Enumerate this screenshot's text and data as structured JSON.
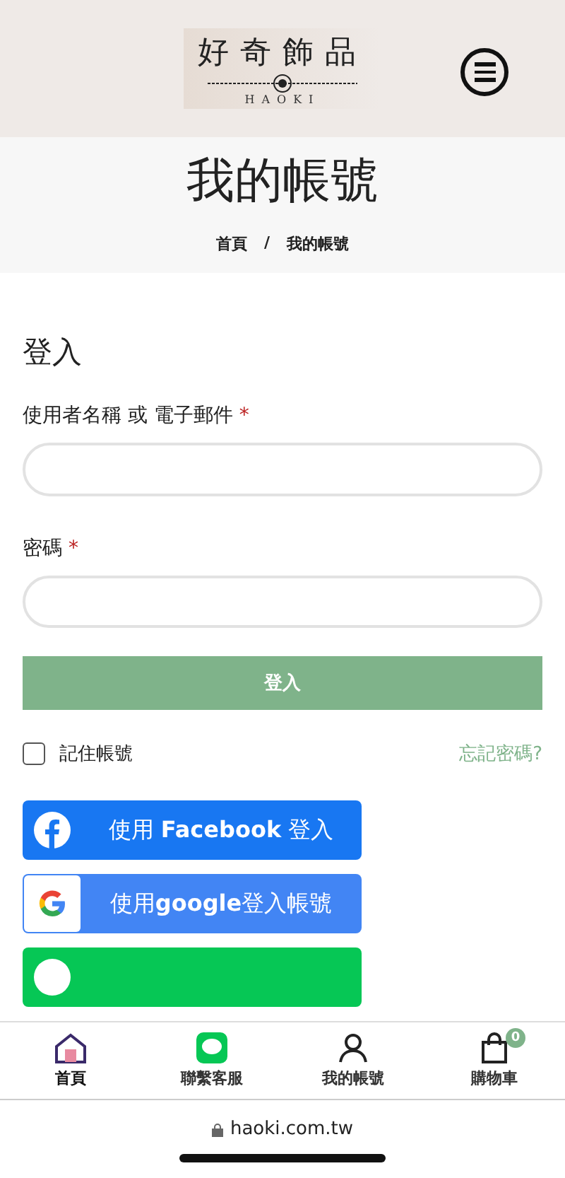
{
  "header": {
    "logo_text": "好奇飾品",
    "logo_subtitle": "HAOKI"
  },
  "page_title": "我的帳號",
  "breadcrumb": [
    "首頁",
    "/",
    "我的帳號"
  ],
  "login": {
    "heading": "登入",
    "fields": [
      {
        "label": "使用者名稱 或 電子郵件",
        "required_mark": "*"
      },
      {
        "label": "密碼",
        "required_mark": "*"
      }
    ],
    "submit": "登入",
    "remember": {
      "label": "記住帳號",
      "checked": false
    },
    "forgot": "忘記密碼?"
  },
  "social_buttons": [
    {
      "kind": "facebook",
      "label": "使用 **Facebook** 登入"
    },
    {
      "kind": "google",
      "label": "使用**google**登入帳號"
    },
    {
      "kind": "line"
    }
  ],
  "tab_bar": [
    {
      "kind": "home",
      "label": "首頁",
      "selected": true
    },
    {
      "kind": "chat",
      "label": "聯繫客服",
      "selected": false
    },
    {
      "kind": "user",
      "label": "我的帳號",
      "selected": false
    },
    {
      "kind": "cart",
      "label": "購物車",
      "selected": false,
      "badge": "0"
    }
  ],
  "browser": {
    "url": "haoki.com.tw"
  }
}
